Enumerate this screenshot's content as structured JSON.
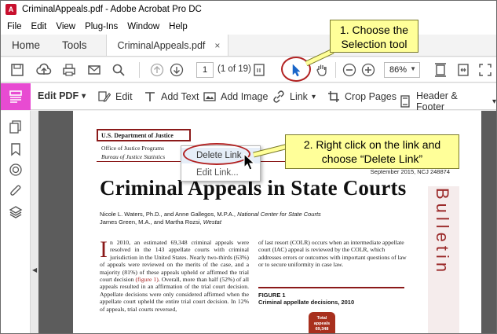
{
  "window": {
    "title": "CriminalAppeals.pdf - Adobe Acrobat Pro DC",
    "logo_letter": "A"
  },
  "menu": [
    "File",
    "Edit",
    "View",
    "Plug-Ins",
    "Window",
    "Help"
  ],
  "tabs": {
    "home": "Home",
    "tools": "Tools",
    "document": "CriminalAppeals.pdf",
    "close": "×"
  },
  "toolbar": {
    "page_number": "1",
    "page_count": "(1 of 19)",
    "zoom": "86%",
    "zoom_arrow": "▼",
    "icons": [
      "save-icon",
      "cloud-upload-icon",
      "print-icon",
      "email-icon",
      "search-icon",
      "prev-page-icon",
      "next-page-icon",
      "page-thumbnail-icon",
      "selection-arrow-icon",
      "hand-tool-icon",
      "zoom-out-icon",
      "zoom-in-icon",
      "fit-page-icon",
      "fit-width-icon",
      "expand-icon"
    ]
  },
  "edit_toolbar": {
    "mode": "Edit PDF",
    "mode_arrow": "▾",
    "edit": "Edit",
    "add_text": "Add Text",
    "add_image": "Add Image",
    "link": "Link",
    "link_arrow": "▾",
    "crop_pages": "Crop Pages",
    "header_footer": "Header & Footer",
    "header_footer_arrow": "▾"
  },
  "sidebar": {
    "icons": [
      "pages-icon",
      "bookmark-icon",
      "layers-target-icon",
      "attachment-icon",
      "layers-icon"
    ],
    "collapse_arrow": "◀"
  },
  "document": {
    "doj": "U.S. Department of Justice",
    "office": "Office of Justice Programs",
    "bureau": "Bureau of Justice Statistics",
    "dateline": "September 2015, NCJ 248874",
    "headline": "Criminal Appeals in State Courts",
    "authors_line1_a": "Nicole L. Waters, Ph.D., and Anne Gallegos, M.P.A., ",
    "authors_line1_b": "National Center for State Courts",
    "authors_line2_a": "James Green, M.A., and Martha Rozsi, ",
    "authors_line2_b": "Westat",
    "bulletin": "Bulletin",
    "dropcap": "I",
    "col_left_a": "n 2010, an estimated 69,348 criminal appeals were resolved in the 143 appellate courts with criminal jurisdiction in the United States. Nearly two-thirds (63%) of appeals were reviewed on the merits of the case, and a majority (81%) of these appeals upheld or affirmed the trial court decision ",
    "col_left_link": "(figure 1)",
    "col_left_b": ". Overall, more than half (52%) of all appeals resulted in an affirmation of the trial court decision. Appellate decisions were only considered affirmed when the appellate court upheld the entire trial court decision. In 12% of appeals, trial courts reversed,",
    "col_right": "of last resort (COLR) occurs when an intermediate appellate court (IAC) appeal is reviewed by the COLR, which addresses errors or outcomes with important questions of law or to secure uniformity in case law.",
    "figure_label": "FIGURE 1",
    "figure_title": "Criminal appellate decisions, 2010",
    "figure_bubble_1": "Total appeals",
    "figure_bubble_2": "69,348"
  },
  "context_menu": {
    "delete_link": "Delete Link",
    "edit_link": "Edit Link..."
  },
  "callouts": {
    "step1_line1": "1. Choose the",
    "step1_line2": "Selection tool",
    "step2_line1": "2. Right click on the link and",
    "step2_line2": "choose “Delete Link”"
  },
  "colors": {
    "accent": "#e84bd2",
    "annotation_red": "#b22222",
    "callout_bg": "#ffff99",
    "selection_blue": "#1a66c9"
  }
}
